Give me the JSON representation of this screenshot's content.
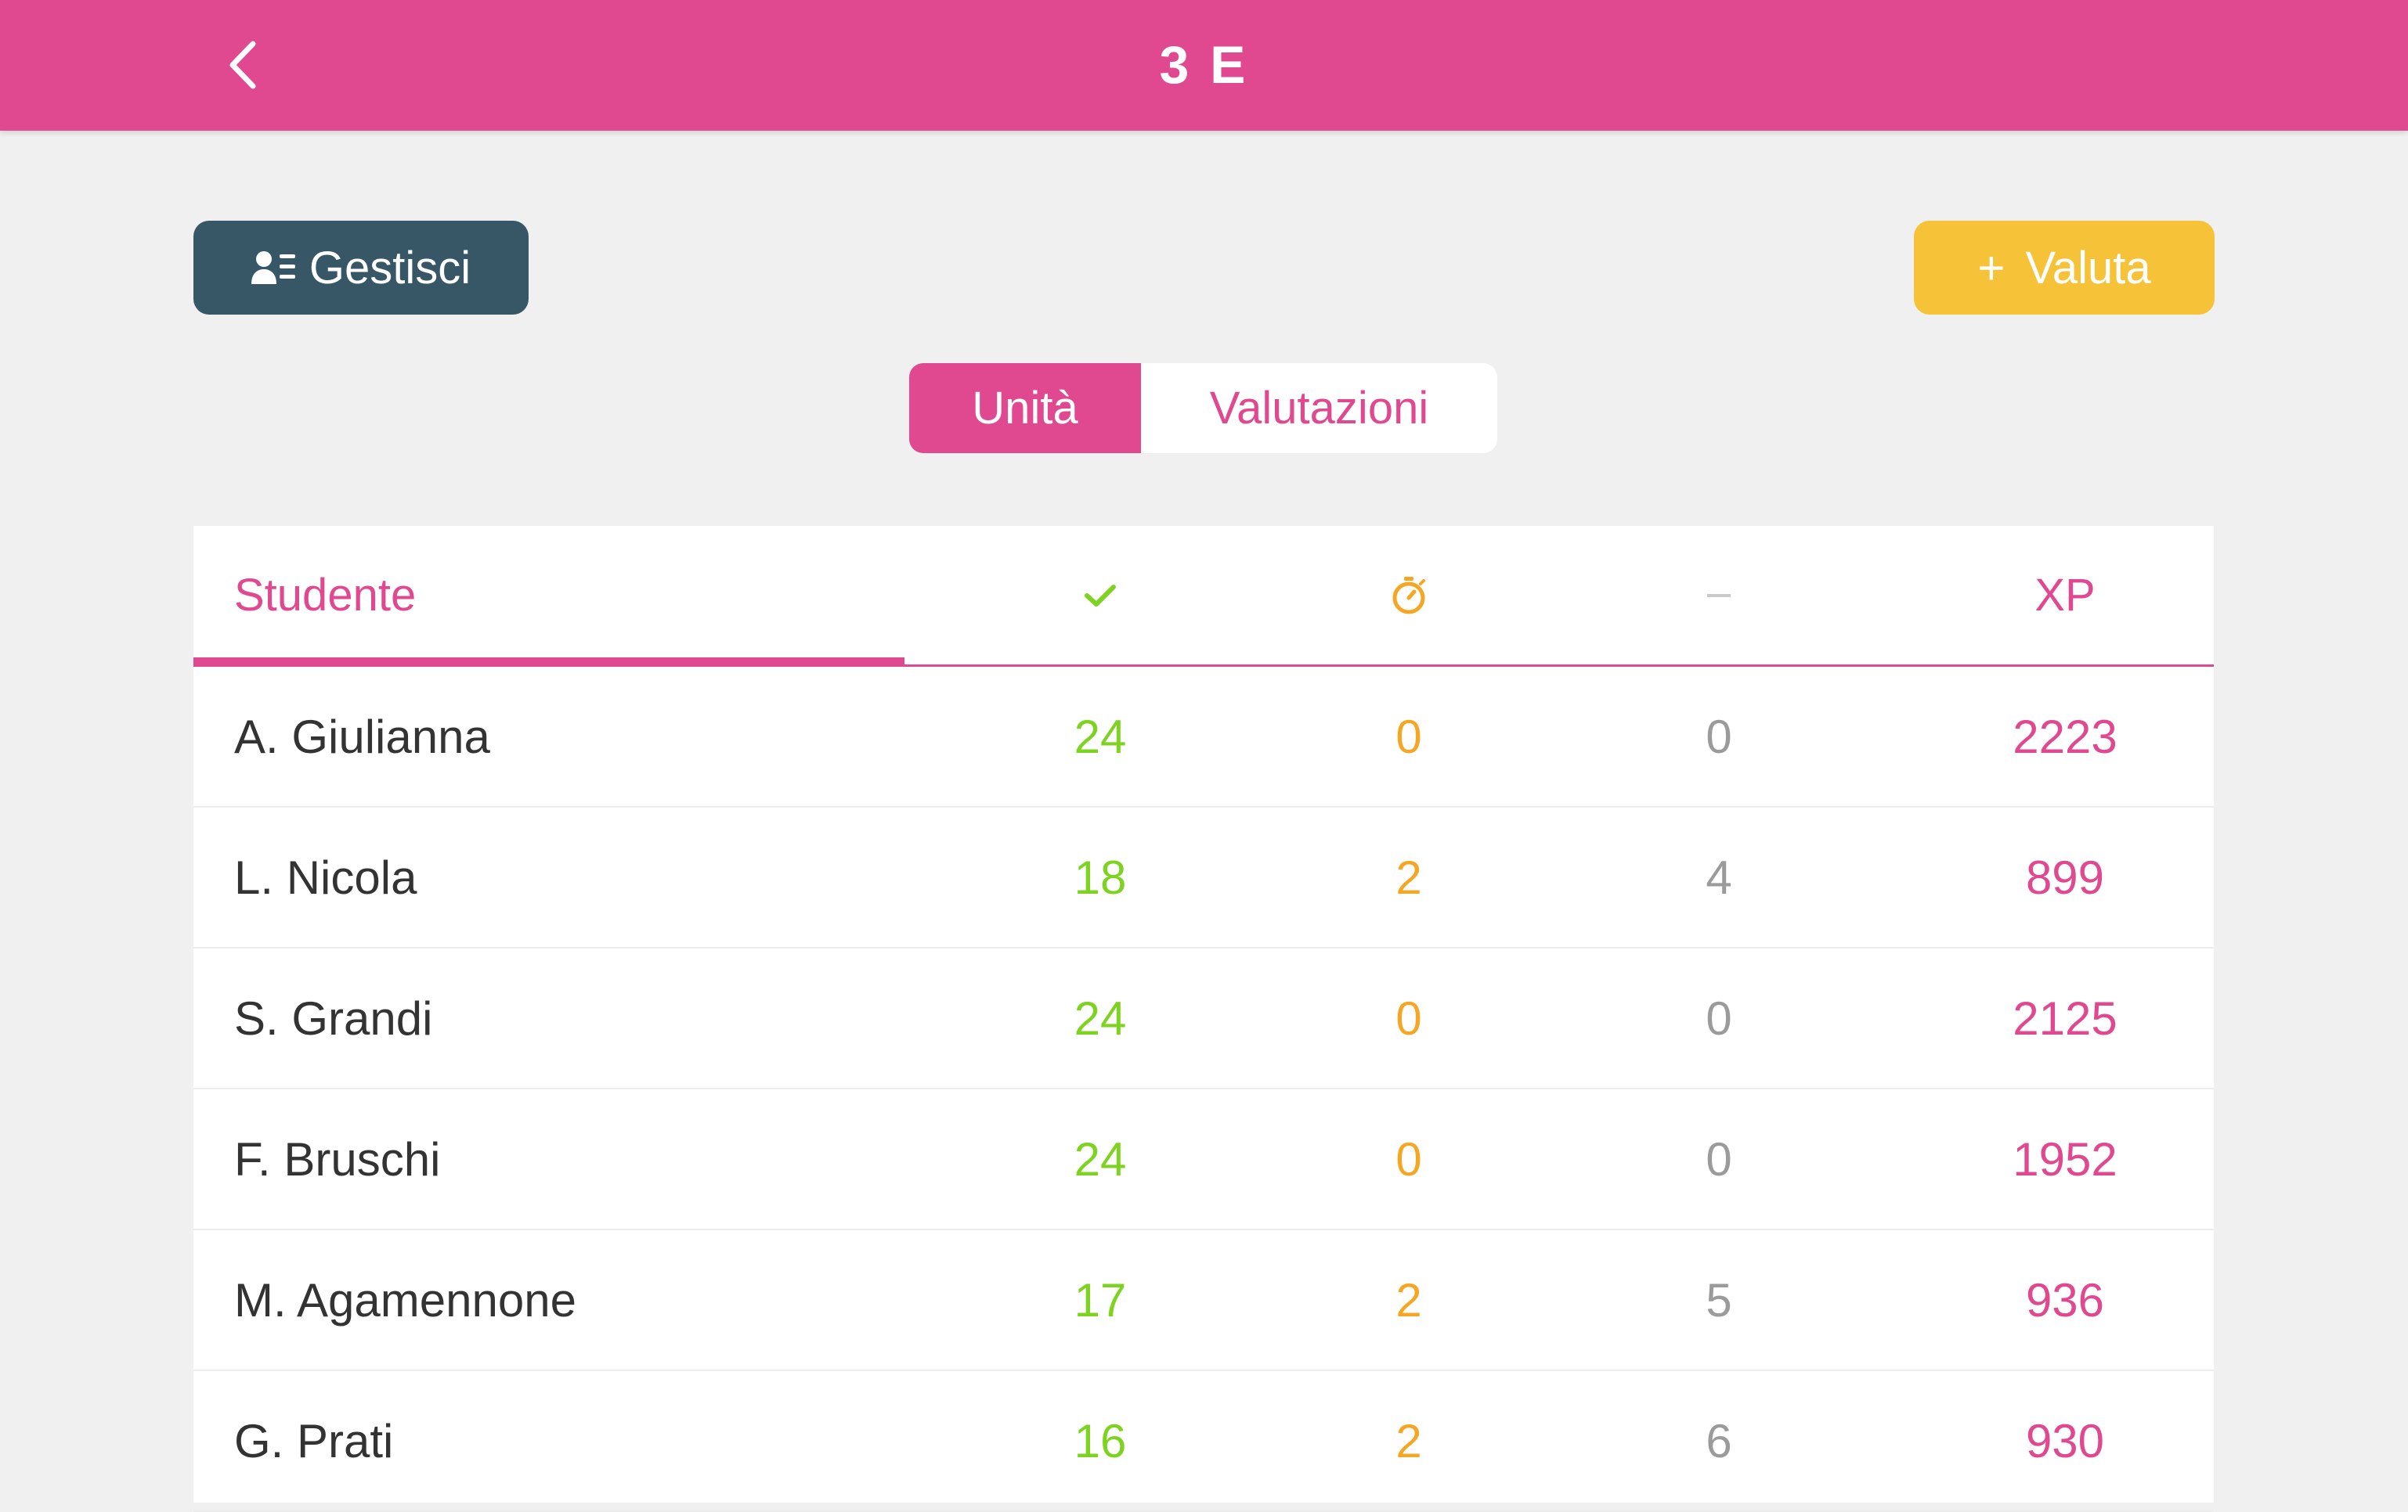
{
  "header": {
    "title": "3 E"
  },
  "toolbar": {
    "manage_label": "Gestisci",
    "eval_plus": "+",
    "eval_label": "Valuta"
  },
  "tabs": [
    {
      "label": "Unità",
      "active": true
    },
    {
      "label": "Valutazioni",
      "active": false
    }
  ],
  "table": {
    "headers": {
      "student": "Studente",
      "completed_icon": "check-icon",
      "in_progress_icon": "stopwatch-icon",
      "not_started_icon": "dash-icon",
      "xp": "XP"
    },
    "rows": [
      {
        "name": "A. Giulianna",
        "completed": "24",
        "in_progress": "0",
        "not_started": "0",
        "xp": "2223"
      },
      {
        "name": "L. Nicola",
        "completed": "18",
        "in_progress": "2",
        "not_started": "4",
        "xp": "899"
      },
      {
        "name": "S. Grandi",
        "completed": "24",
        "in_progress": "0",
        "not_started": "0",
        "xp": "2125"
      },
      {
        "name": "F. Bruschi",
        "completed": "24",
        "in_progress": "0",
        "not_started": "0",
        "xp": "1952"
      },
      {
        "name": "M. Agamennone",
        "completed": "17",
        "in_progress": "2",
        "not_started": "5",
        "xp": "936"
      },
      {
        "name": "G. Prati",
        "completed": "16",
        "in_progress": "2",
        "not_started": "6",
        "xp": "930"
      }
    ]
  },
  "colors": {
    "brand": "#e0498f",
    "manage_button": "#375766",
    "eval_button": "#f6c338",
    "completed": "#7ed321",
    "in_progress": "#f5a623",
    "not_started": "#9b9b9b"
  }
}
